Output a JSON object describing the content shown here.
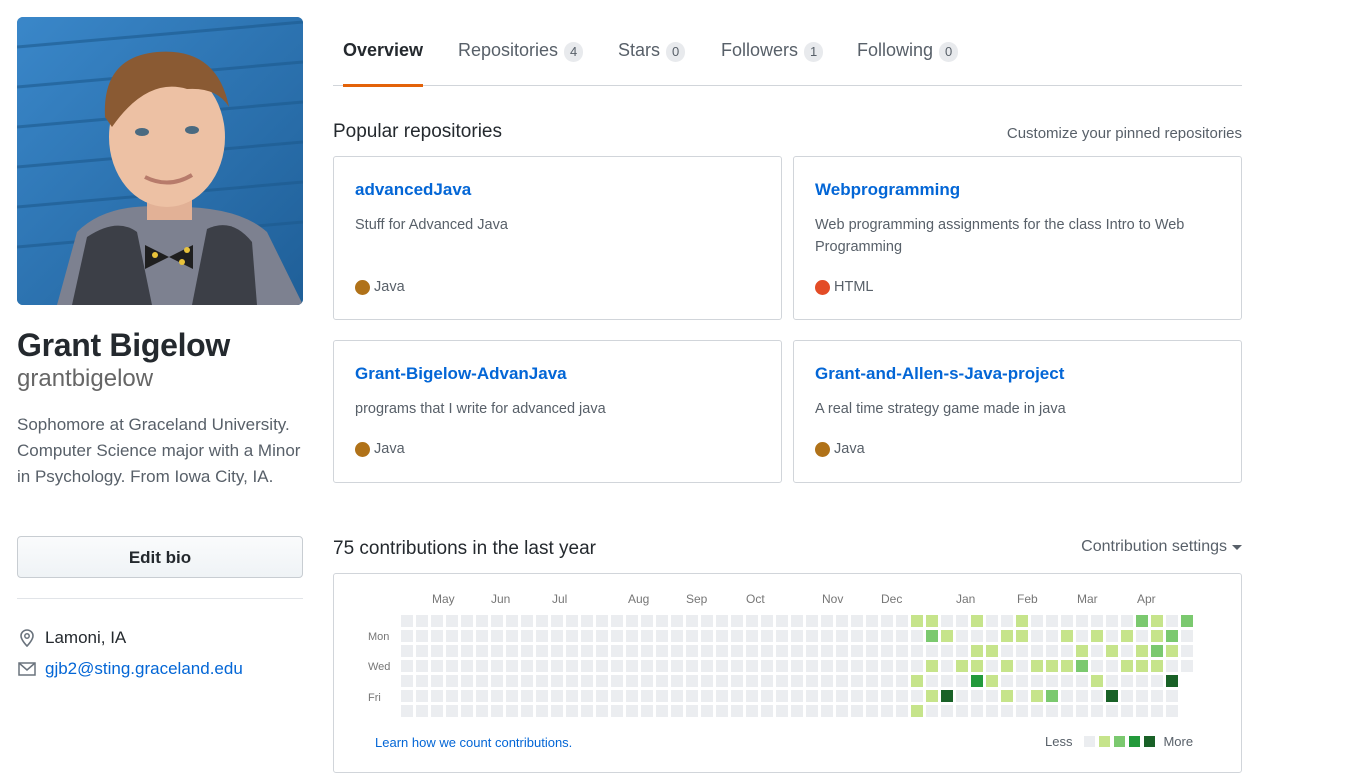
{
  "profile": {
    "full_name": "Grant Bigelow",
    "username": "grantbigelow",
    "bio": "Sophomore at Graceland University. Computer Science major with a Minor in Psychology. From Iowa City, IA.",
    "edit_bio_label": "Edit bio",
    "location": "Lamoni, IA",
    "email": "gjb2@sting.graceland.edu",
    "location_icon": "location-pin-icon",
    "email_icon": "mail-icon"
  },
  "tabs": [
    {
      "label": "Overview",
      "count": null,
      "selected": true
    },
    {
      "label": "Repositories",
      "count": "4",
      "selected": false
    },
    {
      "label": "Stars",
      "count": "0",
      "selected": false
    },
    {
      "label": "Followers",
      "count": "1",
      "selected": false
    },
    {
      "label": "Following",
      "count": "0",
      "selected": false
    }
  ],
  "pinned": {
    "title": "Popular repositories",
    "customize_label": "Customize your pinned repositories",
    "repos": [
      {
        "name": "advancedJava",
        "description": "Stuff for Advanced Java",
        "language": "Java",
        "language_color": "#b07219"
      },
      {
        "name": "Webprogramming",
        "description": "Web programming assignments for the class Intro to Web Programming",
        "language": "HTML",
        "language_color": "#e34c26"
      },
      {
        "name": "Grant-Bigelow-AdvanJava",
        "description": "programs that I write for advanced java",
        "language": "Java",
        "language_color": "#b07219"
      },
      {
        "name": "Grant-and-Allen-s-Java-project",
        "description": "A real time strategy game made in java",
        "language": "Java",
        "language_color": "#b07219"
      }
    ]
  },
  "contributions": {
    "title": "75 contributions in the last year",
    "settings_label": "Contribution settings",
    "months": [
      "May",
      "Jun",
      "Jul",
      "Aug",
      "Sep",
      "Oct",
      "Nov",
      "Dec",
      "Jan",
      "Feb",
      "Mar",
      "Apr"
    ],
    "day_labels": [
      "Mon",
      "Wed",
      "Fri"
    ],
    "learn_label": "Learn how we count contributions.",
    "legend_less": "Less",
    "legend_more": "More",
    "level_colors": [
      "#ebedf0",
      "#c6e48b",
      "#7bc96f",
      "#239a3b",
      "#196127"
    ],
    "weeks": 53,
    "last_week_days": 4,
    "active_cells": [
      [
        37,
        0,
        1
      ],
      [
        37,
        4,
        1
      ],
      [
        37,
        6,
        1
      ],
      [
        38,
        0,
        1
      ],
      [
        38,
        1,
        2
      ],
      [
        38,
        3,
        1
      ],
      [
        38,
        5,
        1
      ],
      [
        39,
        1,
        1
      ],
      [
        39,
        5,
        4
      ],
      [
        40,
        3,
        1
      ],
      [
        41,
        0,
        1
      ],
      [
        41,
        2,
        1
      ],
      [
        41,
        3,
        1
      ],
      [
        41,
        4,
        3
      ],
      [
        42,
        2,
        1
      ],
      [
        42,
        4,
        1
      ],
      [
        43,
        1,
        1
      ],
      [
        43,
        3,
        1
      ],
      [
        43,
        5,
        1
      ],
      [
        44,
        0,
        1
      ],
      [
        44,
        1,
        1
      ],
      [
        45,
        3,
        1
      ],
      [
        45,
        5,
        1
      ],
      [
        45,
        7,
        1
      ],
      [
        46,
        3,
        1
      ],
      [
        46,
        5,
        2
      ],
      [
        47,
        1,
        1
      ],
      [
        47,
        3,
        1
      ],
      [
        48,
        2,
        1
      ],
      [
        48,
        3,
        2
      ],
      [
        49,
        1,
        1
      ],
      [
        49,
        4,
        1
      ],
      [
        50,
        2,
        1
      ],
      [
        50,
        5,
        4
      ],
      [
        51,
        1,
        1
      ],
      [
        51,
        3,
        1
      ],
      [
        52,
        0,
        2
      ],
      [
        52,
        2,
        1
      ],
      [
        52,
        3,
        1
      ],
      [
        53,
        0,
        1
      ],
      [
        53,
        1,
        1
      ],
      [
        53,
        2,
        2
      ],
      [
        53,
        3,
        1
      ],
      [
        54,
        1,
        2
      ],
      [
        54,
        2,
        1
      ],
      [
        54,
        4,
        4
      ],
      [
        55,
        0,
        2
      ]
    ]
  }
}
